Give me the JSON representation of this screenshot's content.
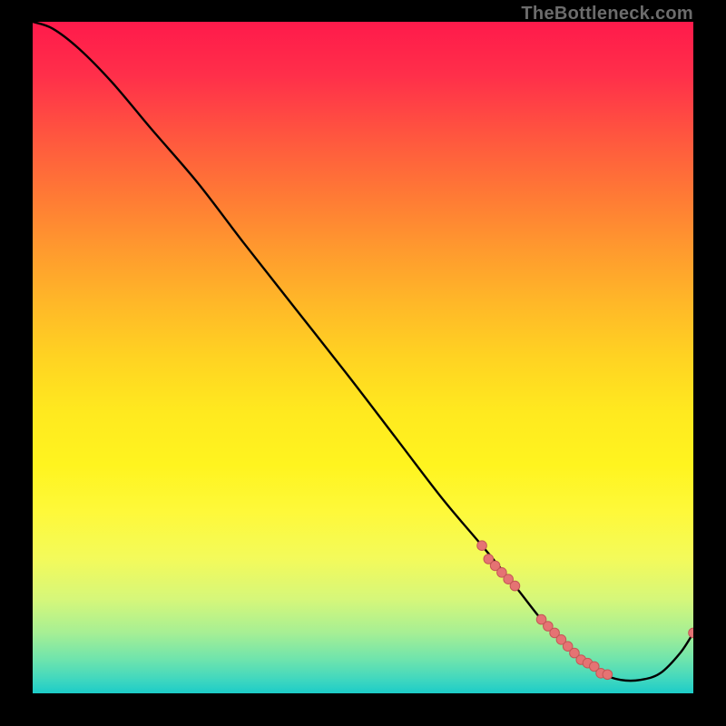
{
  "watermark": "TheBottleneck.com",
  "colors": {
    "background": "#000000",
    "curve": "#000000",
    "point_fill": "#e57373",
    "point_stroke": "#c45757"
  },
  "chart_data": {
    "type": "line",
    "title": "",
    "xlabel": "",
    "ylabel": "",
    "xlim": [
      0,
      100
    ],
    "ylim": [
      0,
      100
    ],
    "grid": false,
    "legend": false,
    "series": [
      {
        "name": "bottleneck-curve",
        "x": [
          0,
          3,
          7,
          12,
          18,
          25,
          32,
          40,
          48,
          55,
          62,
          68,
          73,
          77,
          80,
          83,
          86,
          89,
          92,
          95,
          98,
          100
        ],
        "y": [
          100,
          99,
          96,
          91,
          84,
          76,
          67,
          57,
          47,
          38,
          29,
          22,
          16,
          11,
          8,
          5,
          3,
          2,
          2,
          3,
          6,
          9
        ]
      }
    ],
    "points": {
      "name": "highlighted-points",
      "x": [
        68,
        69,
        70,
        71,
        72,
        73,
        77,
        78,
        79,
        80,
        81,
        82,
        83,
        84,
        85,
        86,
        87,
        100
      ],
      "y": [
        22,
        20,
        19,
        18,
        17,
        16,
        11,
        10,
        9,
        8,
        7,
        6,
        5,
        4.5,
        4,
        3,
        2.8,
        9
      ]
    }
  }
}
